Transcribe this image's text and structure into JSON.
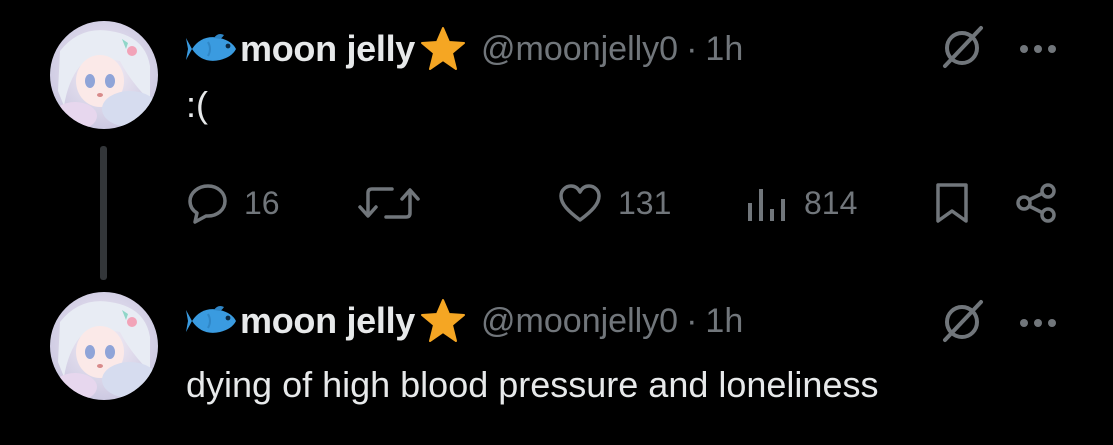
{
  "colors": {
    "background": "#000000",
    "text_primary": "#e7e9ea",
    "text_secondary": "#71767b",
    "thread_line": "#333639",
    "fish": "#3a9be0",
    "star": "#f5a623"
  },
  "tweets": [
    {
      "author": {
        "display_name": "moon jelly",
        "prefix_emoji": "fish-icon",
        "suffix_emoji": "star-icon",
        "handle": "@moonjelly0",
        "separator": "·",
        "time": "1h"
      },
      "text": ":(",
      "actions": {
        "replies": "16",
        "retweets": "",
        "likes": "131",
        "views": "814"
      }
    },
    {
      "author": {
        "display_name": "moon jelly",
        "prefix_emoji": "fish-icon",
        "suffix_emoji": "star-icon",
        "handle": "@moonjelly0",
        "separator": "·",
        "time": "1h"
      },
      "text": "dying of high blood pressure and loneliness"
    }
  ]
}
